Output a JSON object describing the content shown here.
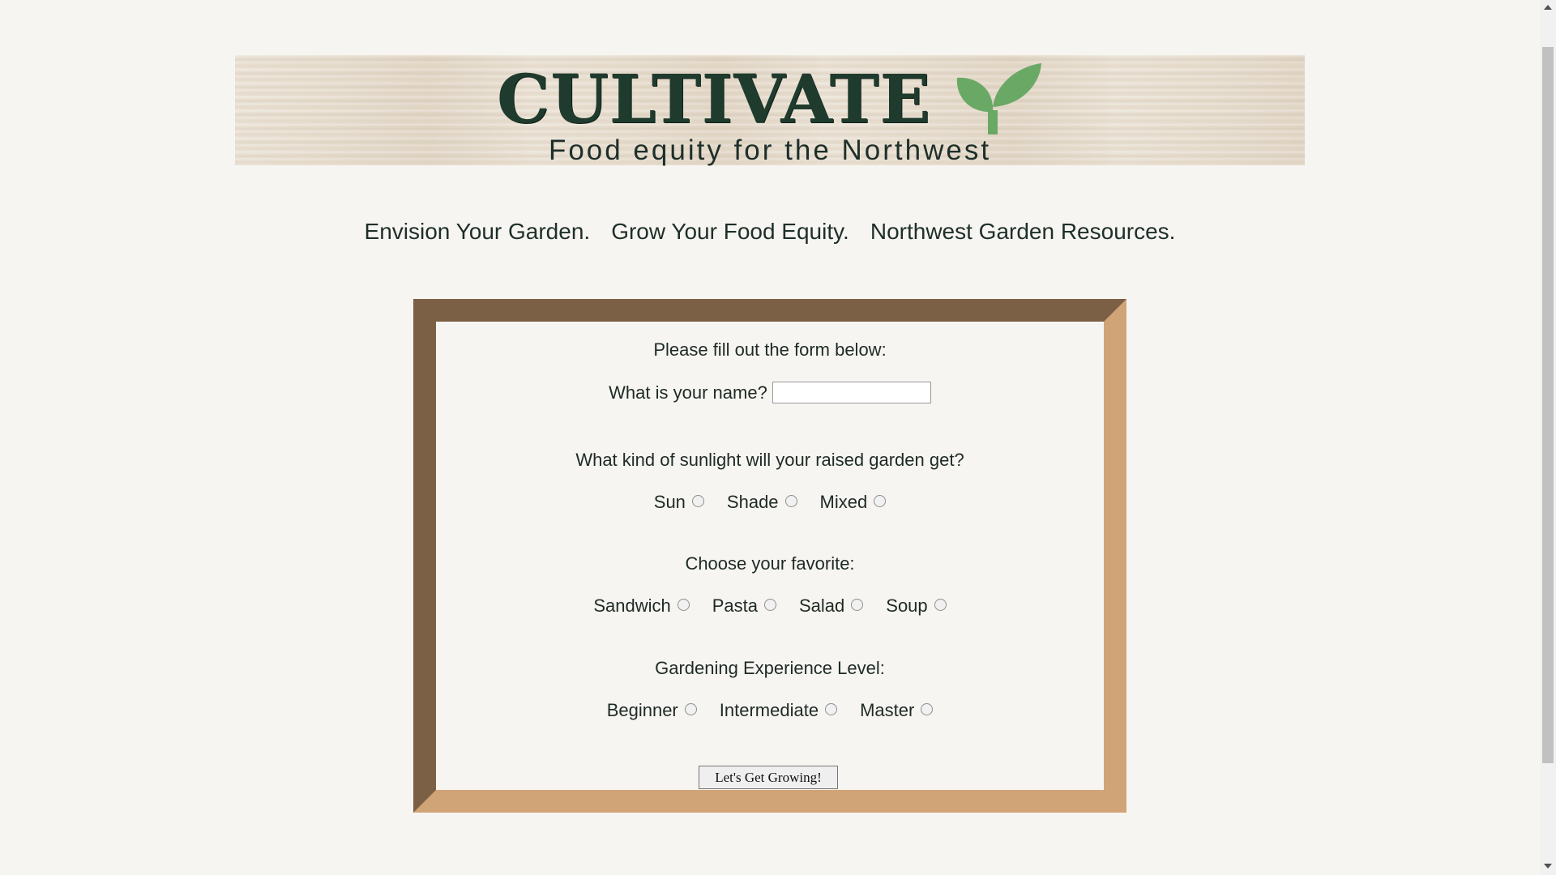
{
  "header": {
    "logo_text": "CULTIVATE",
    "tagline": "Food equity for the Northwest",
    "sprout_color": "#6aa866"
  },
  "nav": {
    "items": [
      {
        "label": "Envision Your Garden."
      },
      {
        "label": "Grow Your Food Equity."
      },
      {
        "label": "Northwest Garden Resources."
      }
    ]
  },
  "form": {
    "title": "Please fill out the form below:",
    "name_label": "What is your name?",
    "name_value": "",
    "sunlight_question": "What kind of sunlight will your raised garden get?",
    "sunlight_options": [
      "Sun",
      "Shade",
      "Mixed"
    ],
    "favorite_question": "Choose your favorite:",
    "favorite_options": [
      "Sandwich",
      "Pasta",
      "Salad",
      "Soup"
    ],
    "experience_question": "Gardening Experience Level:",
    "experience_options": [
      "Beginner",
      "Intermediate",
      "Master"
    ],
    "submit_label": "Let's Get Growing!"
  },
  "colors": {
    "frame_dark": "#7b6046",
    "frame_light": "#d1a477",
    "background": "#f7f5f1",
    "text": "#1e2a26"
  }
}
